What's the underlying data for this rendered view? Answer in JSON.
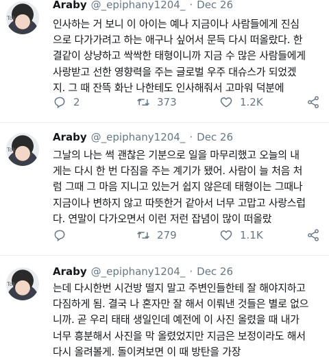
{
  "tweets": [
    {
      "name": "Araby",
      "handle": "@_epiphany1204_",
      "separator": "·",
      "date": "Dec 26",
      "avatar_watermark": "Tok",
      "text": "인사하는 거 보니 이 아이는 예나 지금이나 사람들에게 진심\n으로 다가가려고 하는 애구나 싶어서 문득 다시 떠올랐다. 한\n결같이 상냥하고 싹싹한 태형이니까 지금 수 많은 사람들에게\n사랑받고 선한 영향력을 주는 글로벌 우주 대슈스가 되었겠\n지. 그 때 잔뜩 화난 나한테도 인사해줘서 고마워 덕분에",
      "replies": "2",
      "retweets": "373",
      "likes": "1.2K"
    },
    {
      "name": "Araby",
      "handle": "@_epiphany1204_",
      "separator": "·",
      "date": "Dec 26",
      "avatar_watermark": "Tok",
      "text": "그날의 나는 썩 괜찮은 기분으로 일을 마무리했고 오늘의 내\n게는 다시 한 번 다짐을 주는 계기가 됐어. 사람이 늘 처음 처\n럼 그때 그 마음 지니고 있는거 쉽지 않은데 태형이는 그때나\n지금이나 변하지 않고 따뜻한거 같아서 너무 고맙고 사랑스럽\n다. 연말이 다가오면서 이런 저런 잡념이 많이 떠올랐",
      "replies": "",
      "retweets": "279",
      "likes": "1.1K"
    },
    {
      "name": "Araby",
      "handle": "@_epiphany1204_",
      "separator": "·",
      "date": "Dec 26",
      "avatar_watermark": "Tok",
      "text": "는데 다시한번 시건방 떨지 말고 주변인들한테 잘 해야지하고\n다짐하게 됨. 결국 나 혼자만 잘 해서 이뤄낸 것들은 별로 없으\n니까. 곧 우리 태태 생일인데 예전에 이 사진 올렸을 때 내가\n너무 흥분해서 사진을 막 올렸었지만 지금은 보정이라도 해서\n다시 올려볼게. 돌이켜보면 이 때 방탄을 가장",
      "replies": "",
      "retweets": "",
      "likes": ""
    }
  ],
  "icons": {
    "reply": "reply-icon",
    "retweet": "retweet-icon",
    "like": "heart-icon",
    "share": "share-icon"
  },
  "colors": {
    "text": "#14171a",
    "secondary": "#657786",
    "divider": "#e6ecf0"
  }
}
